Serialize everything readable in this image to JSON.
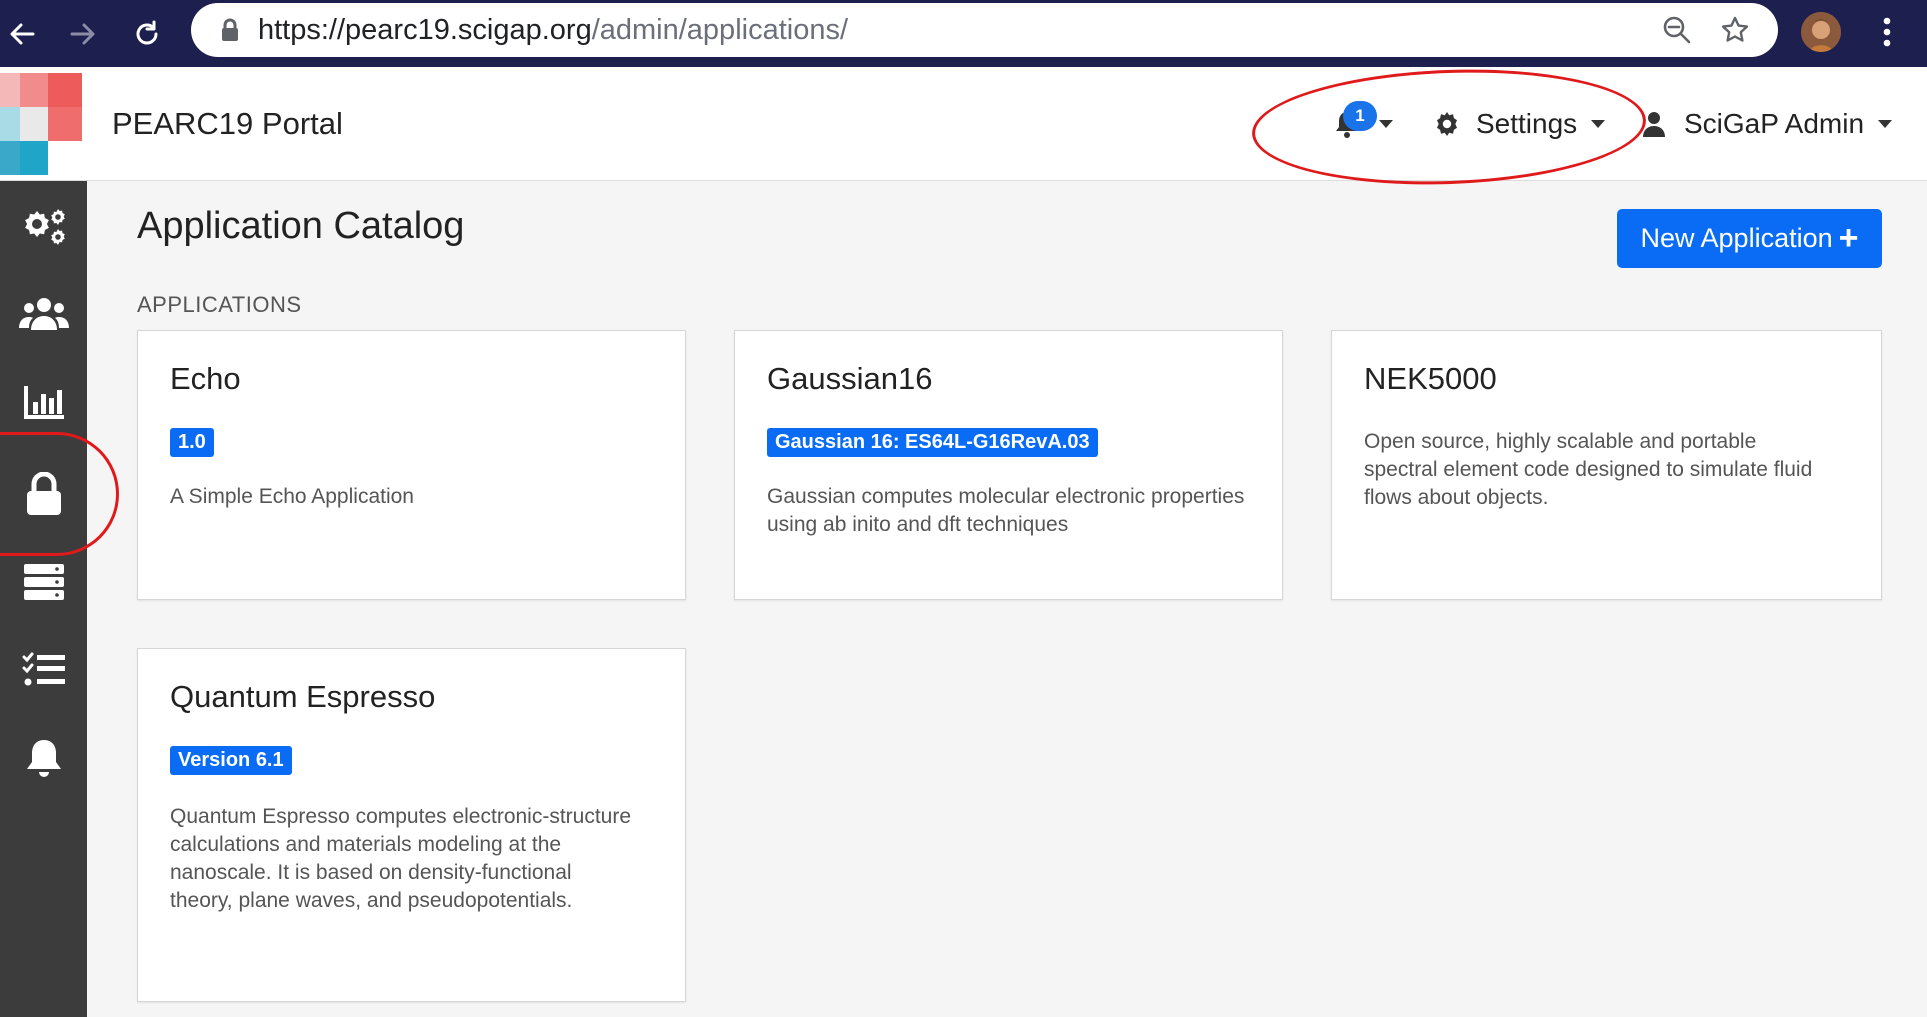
{
  "browser": {
    "url_host": "https://pearc19.scigap.org",
    "url_path": "/admin/applications/",
    "icons": [
      "back-arrow-icon",
      "forward-arrow-icon",
      "reload-icon",
      "lock-icon",
      "zoom-icon",
      "star-icon",
      "profile-avatar",
      "kebab-menu-icon"
    ]
  },
  "header": {
    "portal_title": "PEARC19 Portal",
    "notifications_count": "1",
    "settings_label": "Settings",
    "user_label": "SciGaP Admin"
  },
  "sidebar": {
    "items": [
      {
        "icon": "gears-icon"
      },
      {
        "icon": "users-icon"
      },
      {
        "icon": "bar-chart-icon"
      },
      {
        "icon": "lock-icon"
      },
      {
        "icon": "server-icon"
      },
      {
        "icon": "checklist-icon"
      },
      {
        "icon": "bell-icon"
      }
    ]
  },
  "main": {
    "title": "Application Catalog",
    "new_button_label": "New Application",
    "new_button_icon": "+",
    "section_label": "APPLICATIONS",
    "cards": [
      {
        "name": "Echo",
        "badge": "1.0",
        "description": "A Simple Echo Application"
      },
      {
        "name": "Gaussian16",
        "badge": "Gaussian 16: ES64L-G16RevA.03",
        "description": "Gaussian computes molecular electronic properties using ab inito and dft techniques"
      },
      {
        "name": "NEK5000",
        "badge": "",
        "description": "Open source, highly scalable and portable spectral element code designed to simulate fluid flows about objects."
      },
      {
        "name": "Quantum Espresso",
        "badge": "Version 6.1",
        "description": "Quantum Espresso computes electronic-structure calculations and materials modeling at the nanoscale. It is based on density-functional theory, plane waves, and pseudopotentials."
      }
    ]
  },
  "colors": {
    "browser_bar": "#1d1f4f",
    "primary": "#0a6cf5",
    "sidebar": "#3c3c3c",
    "annotation": "#e0191b"
  }
}
